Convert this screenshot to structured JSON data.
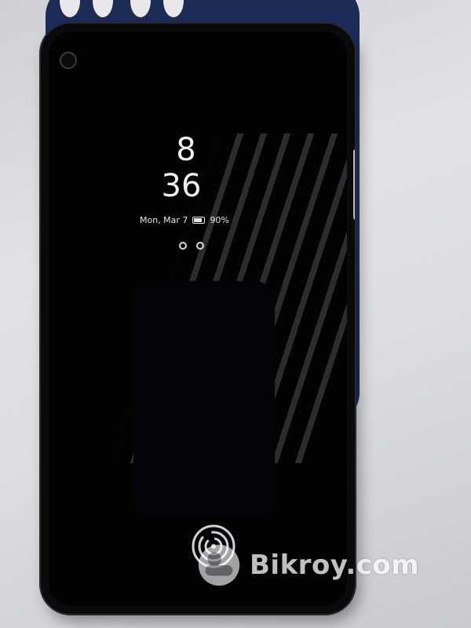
{
  "lock_screen": {
    "hour": "8",
    "minute": "36",
    "date": "Mon, Mar 7",
    "battery": "90%"
  },
  "watermark": {
    "text": "Bikroy.com"
  },
  "icons": {
    "fingerprint": "fingerprint-icon",
    "battery": "battery-icon",
    "notification": "notification-dot-icon",
    "brand_logo": "bikroy-logo-icon"
  },
  "colors": {
    "case": "#243566",
    "screen": "#030304",
    "text": "#eef0f3"
  }
}
